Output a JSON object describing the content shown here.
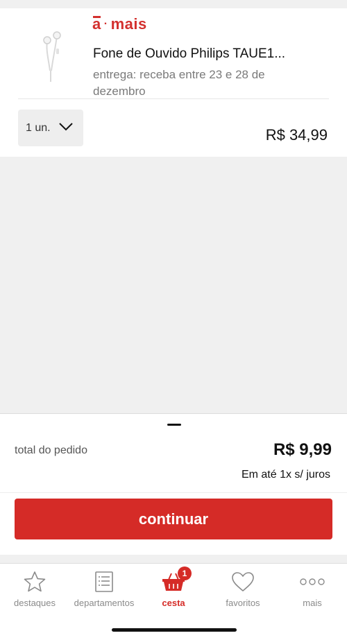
{
  "product": {
    "brand_prefix": "a",
    "brand_sep": "·",
    "brand_suffix": "mais",
    "title": "Fone de Ouvido Philips TAUE1...",
    "delivery": "entrega: receba entre 23 e 28 de dezembro",
    "quantity": "1 un.",
    "price": "R$ 34,99",
    "thumbnail_icon": "earphones-image"
  },
  "summary": {
    "total_label": "total do pedido",
    "total_value": "R$ 9,99",
    "installments": "Em até 1x s/ juros",
    "continue_label": "continuar"
  },
  "tabbar": {
    "items": [
      {
        "label": "destaques",
        "icon": "star-icon",
        "active": false
      },
      {
        "label": "departamentos",
        "icon": "list-icon",
        "active": false
      },
      {
        "label": "cesta",
        "icon": "basket-icon",
        "active": true,
        "badge": "1"
      },
      {
        "label": "favoritos",
        "icon": "heart-icon",
        "active": false
      },
      {
        "label": "mais",
        "icon": "more-icon",
        "active": false
      }
    ]
  },
  "colors": {
    "accent": "#d52b27",
    "background": "#f0f0f0",
    "muted_text": "#8a8a8a"
  }
}
